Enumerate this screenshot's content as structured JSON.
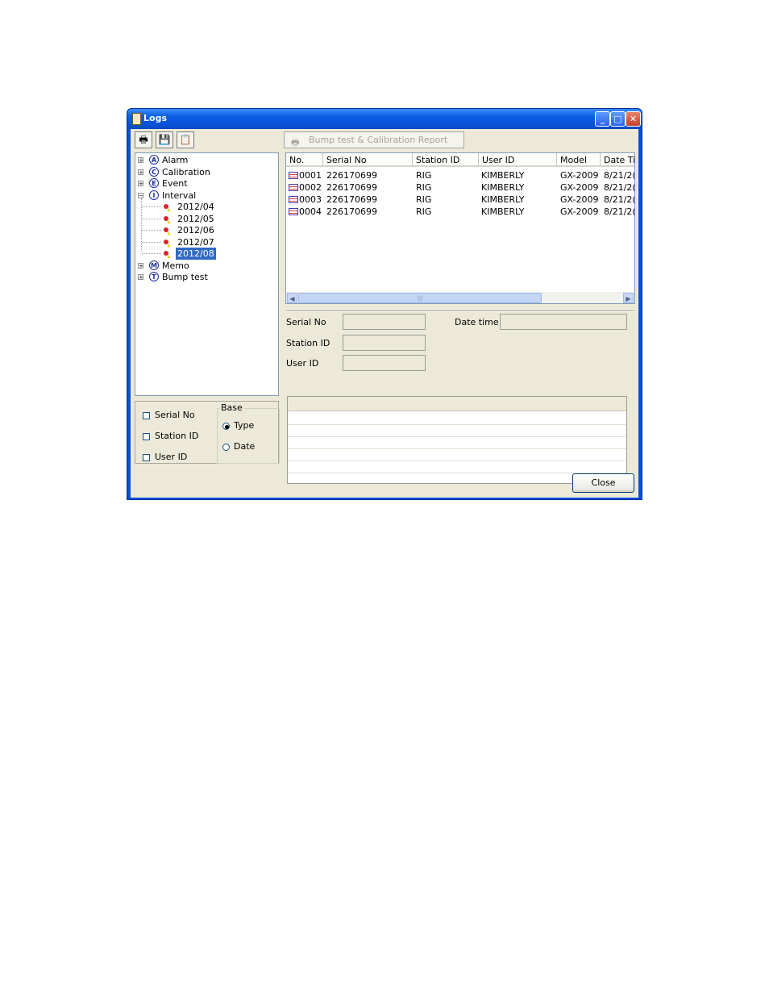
{
  "window": {
    "title": "Logs",
    "caption_buttons": [
      "_",
      "□",
      "✕"
    ]
  },
  "toolbar": {
    "print_icon": "🖶",
    "save_icon": "💾",
    "clipboard_icon": "📋",
    "bump_report_label": "Bump test & Calibration Report"
  },
  "tree": {
    "items": [
      {
        "letter": "A",
        "label": "Alarm",
        "expander": "+"
      },
      {
        "letter": "C",
        "label": "Calibration",
        "expander": "+"
      },
      {
        "letter": "E",
        "label": "Event",
        "expander": "+"
      },
      {
        "letter": "I",
        "label": "Interval",
        "expander": "−"
      },
      {
        "letter": "M",
        "label": "Memo",
        "expander": "+"
      },
      {
        "letter": "T",
        "label": "Bump test",
        "expander": "+"
      }
    ],
    "interval_children": [
      "2012/04",
      "2012/05",
      "2012/06",
      "2012/07",
      "2012/08"
    ],
    "selected": "2012/08"
  },
  "filter": {
    "serial_no": "Serial No",
    "station_id": "Station ID",
    "user_id": "User ID",
    "base_label": "Base",
    "type": "Type",
    "date": "Date"
  },
  "list": {
    "columns": [
      "No.",
      "Serial No",
      "Station ID",
      "User ID",
      "Model",
      "Date Ti"
    ],
    "rows": [
      [
        "0001",
        "226170699",
        "RIG",
        "KIMBERLY",
        "GX-2009",
        "8/21/2("
      ],
      [
        "0002",
        "226170699",
        "RIG",
        "KIMBERLY",
        "GX-2009",
        "8/21/2("
      ],
      [
        "0003",
        "226170699",
        "RIG",
        "KIMBERLY",
        "GX-2009",
        "8/21/2("
      ],
      [
        "0004",
        "226170699",
        "RIG",
        "KIMBERLY",
        "GX-2009",
        "8/21/2("
      ]
    ],
    "scroll_left": "◀",
    "scroll_right": "▶",
    "thumb_grip": "|||"
  },
  "details": {
    "serial_no_label": "Serial No",
    "station_id_label": "Station ID",
    "user_id_label": "User ID",
    "date_time_label": "Date time"
  },
  "buttons": {
    "close": "Close"
  }
}
